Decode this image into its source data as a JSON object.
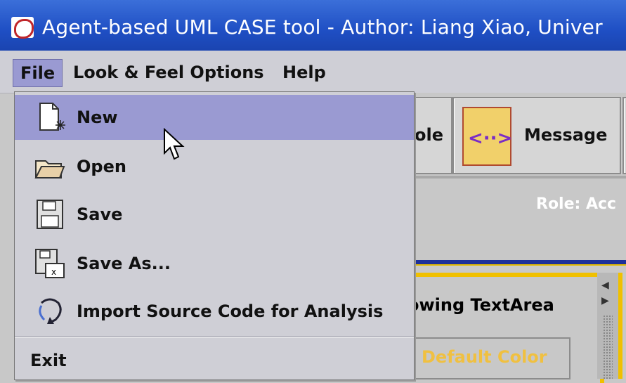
{
  "window": {
    "title": "Agent-based UML CASE tool - Author: Liang Xiao, Univer"
  },
  "menubar": {
    "menus": [
      {
        "label": "File",
        "active": true
      },
      {
        "label": "Look & Feel Options",
        "active": false
      },
      {
        "label": "Help",
        "active": false
      }
    ]
  },
  "file_menu": {
    "items": [
      {
        "label": "New",
        "icon": "new-document-icon"
      },
      {
        "label": "Open",
        "icon": "open-folder-icon"
      },
      {
        "label": "Save",
        "icon": "floppy-disk-icon"
      },
      {
        "label": "Save As...",
        "icon": "save-as-icon"
      },
      {
        "label": "Import Source Code for Analysis",
        "icon": "import-cycle-icon"
      }
    ],
    "exit_label": "Exit",
    "highlighted": "New"
  },
  "toolbar": {
    "role_button_partial": "ole",
    "message_button": "Message"
  },
  "role_panel": {
    "label": "Role: Acc"
  },
  "panel": {
    "textarea_label": "owing TextArea",
    "default_color_button": "Default Color"
  },
  "colors": {
    "title_bar": "#1f4fc4",
    "highlight": "#9a9ad2",
    "frame_yellow": "#f0c000"
  }
}
